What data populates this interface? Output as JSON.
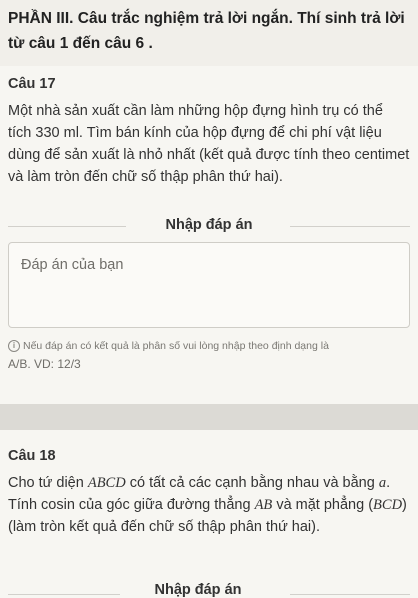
{
  "section": {
    "title": "PHẦN III. Câu trắc nghiệm trả lời ngắn. Thí sinh trả lời từ câu 1 đến câu 6 ."
  },
  "q17": {
    "label": "Câu 17",
    "text": "Một nhà sản xuất cần làm những hộp đựng hình trụ có thể tích 330 ml. Tìm bán kính của hộp đựng để chi phí vật liệu dùng để sản xuất là nhỏ nhất (kết quả được tính theo centimet và làm tròn đến chữ số thập phân thứ hai).",
    "enter_label": "Nhập đáp án",
    "answer_placeholder": "Đáp án của bạn",
    "hint_line1": "Nếu đáp án có kết quả là phân số vui lòng nhập theo định dạng là",
    "hint_line2": "A/B. VD: 12/3"
  },
  "q18": {
    "label": "Câu 18",
    "text_a": "Cho tứ diện ",
    "math_abcd": "ABCD",
    "text_b": " có tất cả các cạnh bằng nhau và bằng ",
    "math_a": "a",
    "text_c": ". Tính cosin của góc giữa đường thẳng ",
    "math_ab": "AB",
    "text_d": " và mặt phẳng (",
    "math_bcd": "BCD",
    "text_e": ") (làm tròn kết quả đến chữ số thập phân thứ hai).",
    "enter_label": "Nhập đáp án"
  }
}
